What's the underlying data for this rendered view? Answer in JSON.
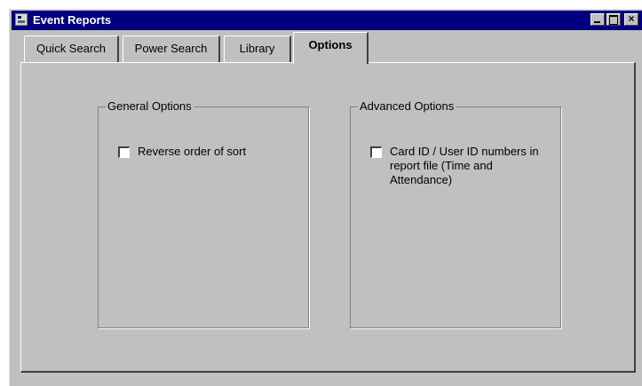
{
  "window": {
    "title": "Event Reports"
  },
  "tabs": [
    {
      "label": "Quick Search"
    },
    {
      "label": "Power Search"
    },
    {
      "label": "Library"
    },
    {
      "label": "Options",
      "active": true
    }
  ],
  "general_options": {
    "title": "General Options",
    "reverse_sort": {
      "label": "Reverse order of sort",
      "checked": false
    }
  },
  "advanced_options": {
    "title": "Advanced Options",
    "card_id": {
      "label": "Card ID / User ID numbers in report file (Time and Attendance)",
      "checked": false
    }
  },
  "colors": {
    "titlebar": "#000080",
    "face": "#c0c0c0"
  }
}
